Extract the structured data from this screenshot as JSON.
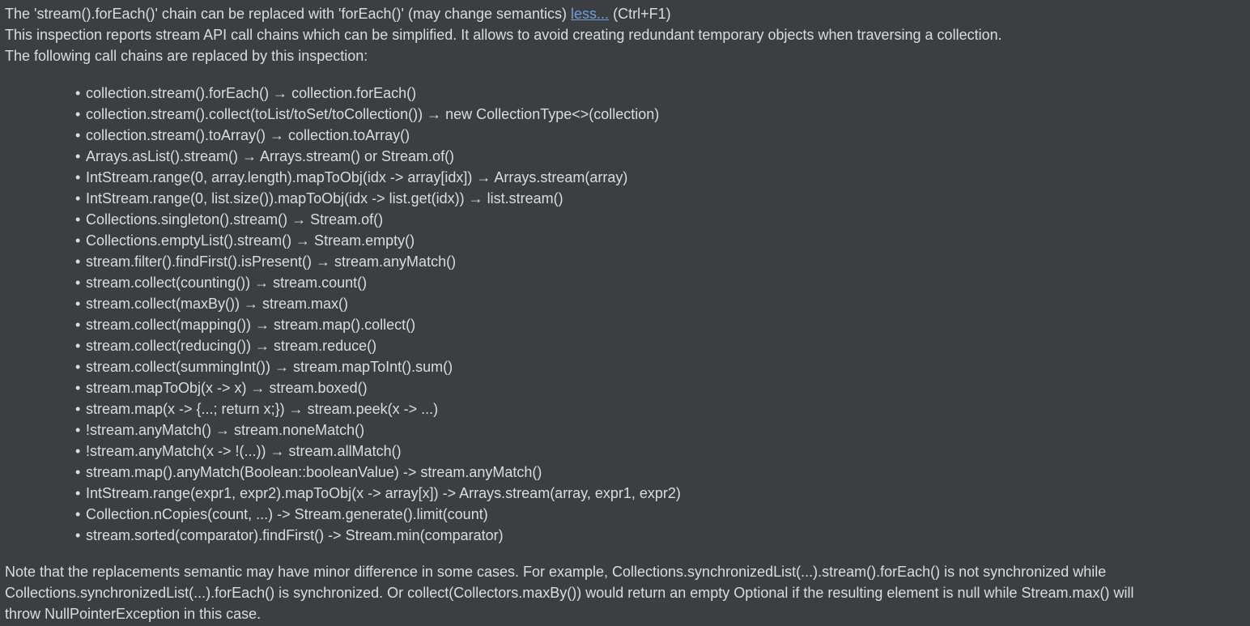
{
  "header": {
    "summary": "The 'stream().forEach()' chain can be replaced with 'forEach()' (may change semantics)",
    "less_link": "less...",
    "shortcut": "(Ctrl+F1)"
  },
  "description": {
    "line1": "This inspection reports stream API call chains which can be simplified. It allows to avoid creating redundant temporary objects when traversing a collection.",
    "line2": "The following call chains are replaced by this inspection:"
  },
  "chains": [
    "collection.stream().forEach() → collection.forEach()",
    "collection.stream().collect(toList/toSet/toCollection()) → new CollectionType<>(collection)",
    "collection.stream().toArray() → collection.toArray()",
    "Arrays.asList().stream() → Arrays.stream() or Stream.of()",
    "IntStream.range(0, array.length).mapToObj(idx -> array[idx]) → Arrays.stream(array)",
    "IntStream.range(0, list.size()).mapToObj(idx -> list.get(idx)) → list.stream()",
    "Collections.singleton().stream() → Stream.of()",
    "Collections.emptyList().stream() → Stream.empty()",
    "stream.filter().findFirst().isPresent() → stream.anyMatch()",
    "stream.collect(counting()) → stream.count()",
    "stream.collect(maxBy()) → stream.max()",
    "stream.collect(mapping()) → stream.map().collect()",
    "stream.collect(reducing()) → stream.reduce()",
    "stream.collect(summingInt()) → stream.mapToInt().sum()",
    "stream.mapToObj(x -> x) → stream.boxed()",
    "stream.map(x -> {...; return x;}) → stream.peek(x -> ...)",
    "!stream.anyMatch() → stream.noneMatch()",
    "!stream.anyMatch(x -> !(...)) → stream.allMatch()",
    "stream.map().anyMatch(Boolean::booleanValue) -> stream.anyMatch()",
    "IntStream.range(expr1, expr2).mapToObj(x -> array[x]) -> Arrays.stream(array, expr1, expr2)",
    "Collection.nCopies(count, ...) -> Stream.generate().limit(count)",
    "stream.sorted(comparator).findFirst() -> Stream.min(comparator)"
  ],
  "note": {
    "line1": "Note that the replacements semantic may have minor difference in some cases. For example, Collections.synchronizedList(...).stream().forEach() is not synchronized while",
    "line2": "Collections.synchronizedList(...).forEach() is synchronized. Or collect(Collectors.maxBy()) would return an empty Optional if the resulting element is null while Stream.max() will",
    "line3": "throw NullPointerException in this case."
  },
  "colors": {
    "background": "#3c3f41",
    "text": "#dcdcdc",
    "link": "#6f9fd8"
  }
}
